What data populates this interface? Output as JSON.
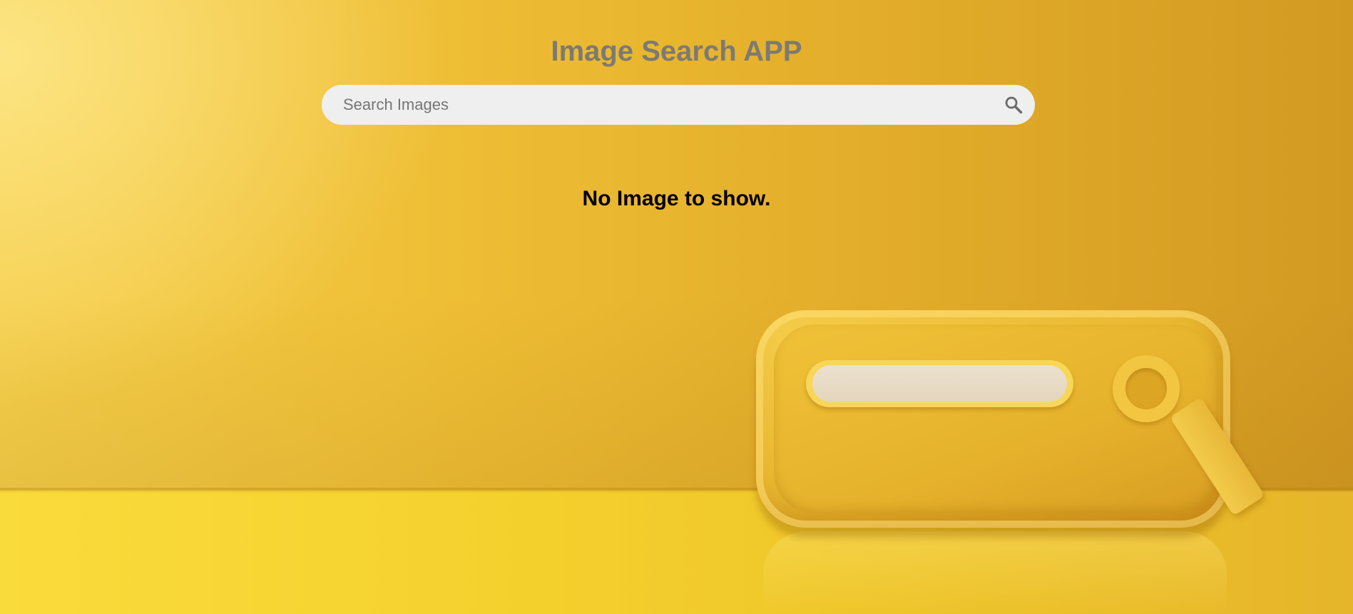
{
  "app": {
    "title": "Image Search APP"
  },
  "search": {
    "placeholder": "Search Images",
    "value": "",
    "button_icon": "search-icon"
  },
  "results": {
    "empty_message": "No Image to show."
  },
  "colors": {
    "title": "#7c7a72",
    "search_background": "#efefef",
    "background_accent": "#e6b12a",
    "message": "#000000"
  }
}
